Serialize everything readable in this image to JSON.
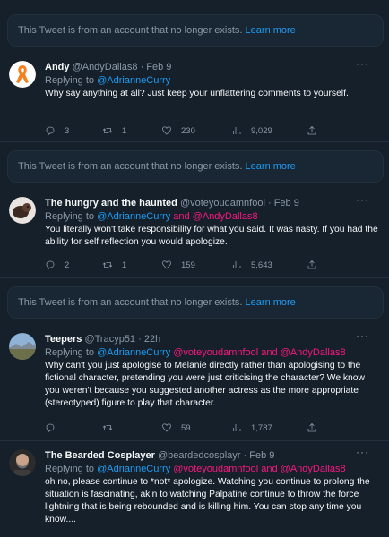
{
  "notices": [
    {
      "text": "This Tweet is from an account that no longer exists.",
      "link": "Learn more"
    },
    {
      "text": "This Tweet is from an account that no longer exists.",
      "link": "Learn more"
    },
    {
      "text": "This Tweet is from an account that no longer exists.",
      "link": "Learn more"
    }
  ],
  "tweets": [
    {
      "name": "Andy",
      "handle": "@AndyDallas8",
      "dot": "·",
      "date": "Feb 9",
      "replying_prefix": "Replying to",
      "replying_to": "@AdrianneCurry",
      "replying_more": "",
      "text": "Why say anything at all?  Just keep your unflattering comments to yourself.",
      "replies": "3",
      "retweets": "1",
      "likes": "230",
      "views": "9,029"
    },
    {
      "name": "The hungry and the haunted",
      "handle": "@voteyoudamnfool",
      "dot": "·",
      "date": "Feb 9",
      "replying_prefix": "Replying to",
      "replying_to": "@AdrianneCurry",
      "replying_more": "and @AndyDallas8",
      "text": "You literally won't take responsibility for what you said. It was nasty. If you had the ability for self reflection you would apologize.",
      "replies": "2",
      "retweets": "1",
      "likes": "159",
      "views": "5,643"
    },
    {
      "name": "Teepers",
      "handle": "@Tracyp51",
      "dot": "·",
      "date": "22h",
      "replying_prefix": "Replying to",
      "replying_to": "@AdrianneCurry",
      "replying_more": "@voteyoudamnfool and @AndyDallas8",
      "text": "Why can't you just apologise to Melanie directly rather than apologising to the fictional character, pretending you were just criticising the character? We know you weren't because you suggested another actress as the more appropriate (stereotyped) figure to play that character.",
      "replies": "",
      "retweets": "",
      "likes": "59",
      "views": "1,787"
    },
    {
      "name": "The Bearded Cosplayer",
      "handle": "@beardedcosplayr",
      "dot": "·",
      "date": "Feb 9",
      "replying_prefix": "Replying to",
      "replying_to": "@AdrianneCurry",
      "replying_more": "@voteyoudamnfool and @AndyDallas8",
      "text": "oh no, please continue to *not* apologize. Watching you continue to prolong the situation is fascinating, akin to watching Palpatine continue to throw the force lightning that is being rebounded and is killing him. You can stop any time you know....",
      "replies": "",
      "retweets": "",
      "likes": "",
      "views": ""
    }
  ],
  "more_icon": "···",
  "colors": {
    "background": "#15202b",
    "link": "#1d9bf0",
    "mention_pink": "#f91880",
    "muted": "#8b98a5"
  }
}
